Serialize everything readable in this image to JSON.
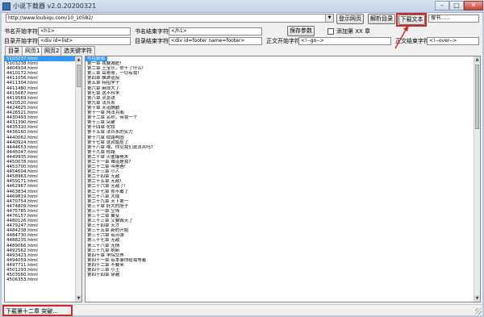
{
  "window": {
    "title": "小说下载器 v2.0.20200321",
    "minimize": "–",
    "maximize": "□",
    "close": "✕"
  },
  "toolbar": {
    "url": "http://www.loubiqu.com/10_10582/",
    "url_dropdown_icon": "▼",
    "login_label": "登示网页",
    "parse_label": "解析目录",
    "download_label": "下载文本",
    "search_placeholder": "搜书......"
  },
  "fields": {
    "book_start_label": "书名开始字符",
    "book_start_value": "<h1>",
    "book_end_label": "书名结束字符",
    "book_end_value": "</h1>",
    "save_params_label": "保存参数",
    "add_chapter_label": "添加第 XX 章",
    "toc_start_label": "目录开始字符",
    "toc_start_value": "<div id=list>",
    "toc_end_label": "目录结束字符",
    "toc_end_value": "<div id=footer name=footer>",
    "content_start_label": "正文开始字符",
    "content_start_value": "<!--go-->",
    "content_end_label": "正文结束字符",
    "content_end_value": "<!--over-->"
  },
  "tabs": [
    "目录",
    "网页1",
    "网页2",
    "选关键字符"
  ],
  "url_list": [
    "5103237.html",
    "5103238.html",
    "4404934.html",
    "4410172.html",
    "4411056.html",
    "4411304.html",
    "4411480.html",
    "4415687.html",
    "4419569.html",
    "4420520.html",
    "4424625.html",
    "4426521.html",
    "4430493.html",
    "4431390.html",
    "4435310.html",
    "4436160.html",
    "4440062.html",
    "4440924.html",
    "4444653.html",
    "4445047.html",
    "4449935.html",
    "4450078.html",
    "4453700.html",
    "4454604.html",
    "4458963.html",
    "4459171.html",
    "4462967.html",
    "4463834.html",
    "4469819.html",
    "4470754.html",
    "4474809.html",
    "4475785.html",
    "4476157.html",
    "4480126.html",
    "4479247.html",
    "4484238.html",
    "4484730.html",
    "4488235.html",
    "4489066.html",
    "4492562.html",
    "4493423.html",
    "4494059.html",
    "4497711.html",
    "4501293.html",
    "4503560.html",
    "4506353.html"
  ],
  "chapter_list": [
    "写在前面",
    "第一章 我要减肥!",
    "第二章 王宝乐，你干了什么!",
    "第三章 岳哥哥，一切有我!",
    "第四章 飘渺道院",
    "第五章 特招学子",
    "第六章 麻烦大了",
    "第七章 这不科学",
    "第八章 灵息诀",
    "第九章 法兵系",
    "第十章 天道酬勤",
    "第十一章 闯法兵阁",
    "第十二章 名师，带我一个",
    "第十三章 突破",
    "第十四章 化妆",
    "第十五章 法兵系的实力",
    "第十六章 纹路构图",
    "第十七章 这就尴尬了",
    "第十八章 喂，你见我们说法兵吗?",
    "第十九章 修路",
    "第二十章 火雀爆骨术",
    "第二十一章 难道是我?",
    "第二十二章 叫爸爸!",
    "第二十三章 小人",
    "第二十四章 无敌",
    "第二十五章 无敌!",
    "第二十六章 无敌了!",
    "第二十七章 你不敢了",
    "第二十八章 大成",
    "第二十九章 天下第一",
    "第三十章 好大的胆子",
    "第三十一章 尘埃",
    "第三十二章 聚变",
    "第三十三章 又要毁天了",
    "第三十四章 天才",
    "第三十五章 新的开始",
    "第三十六章 有点强",
    "第三十七章 无敌",
    "第三十八章 无情",
    "第三十九章 刷新",
    "第四十章 学院交界",
    "第四十一章 有本事你给我等着",
    "第四十二章 不要来",
    "第四十三章 小王",
    "第四十四章 穿越"
  ],
  "status": {
    "text": "下载第十二章 突破..."
  },
  "colors": {
    "highlight": "#d0262a",
    "selection": "#3399ff"
  }
}
